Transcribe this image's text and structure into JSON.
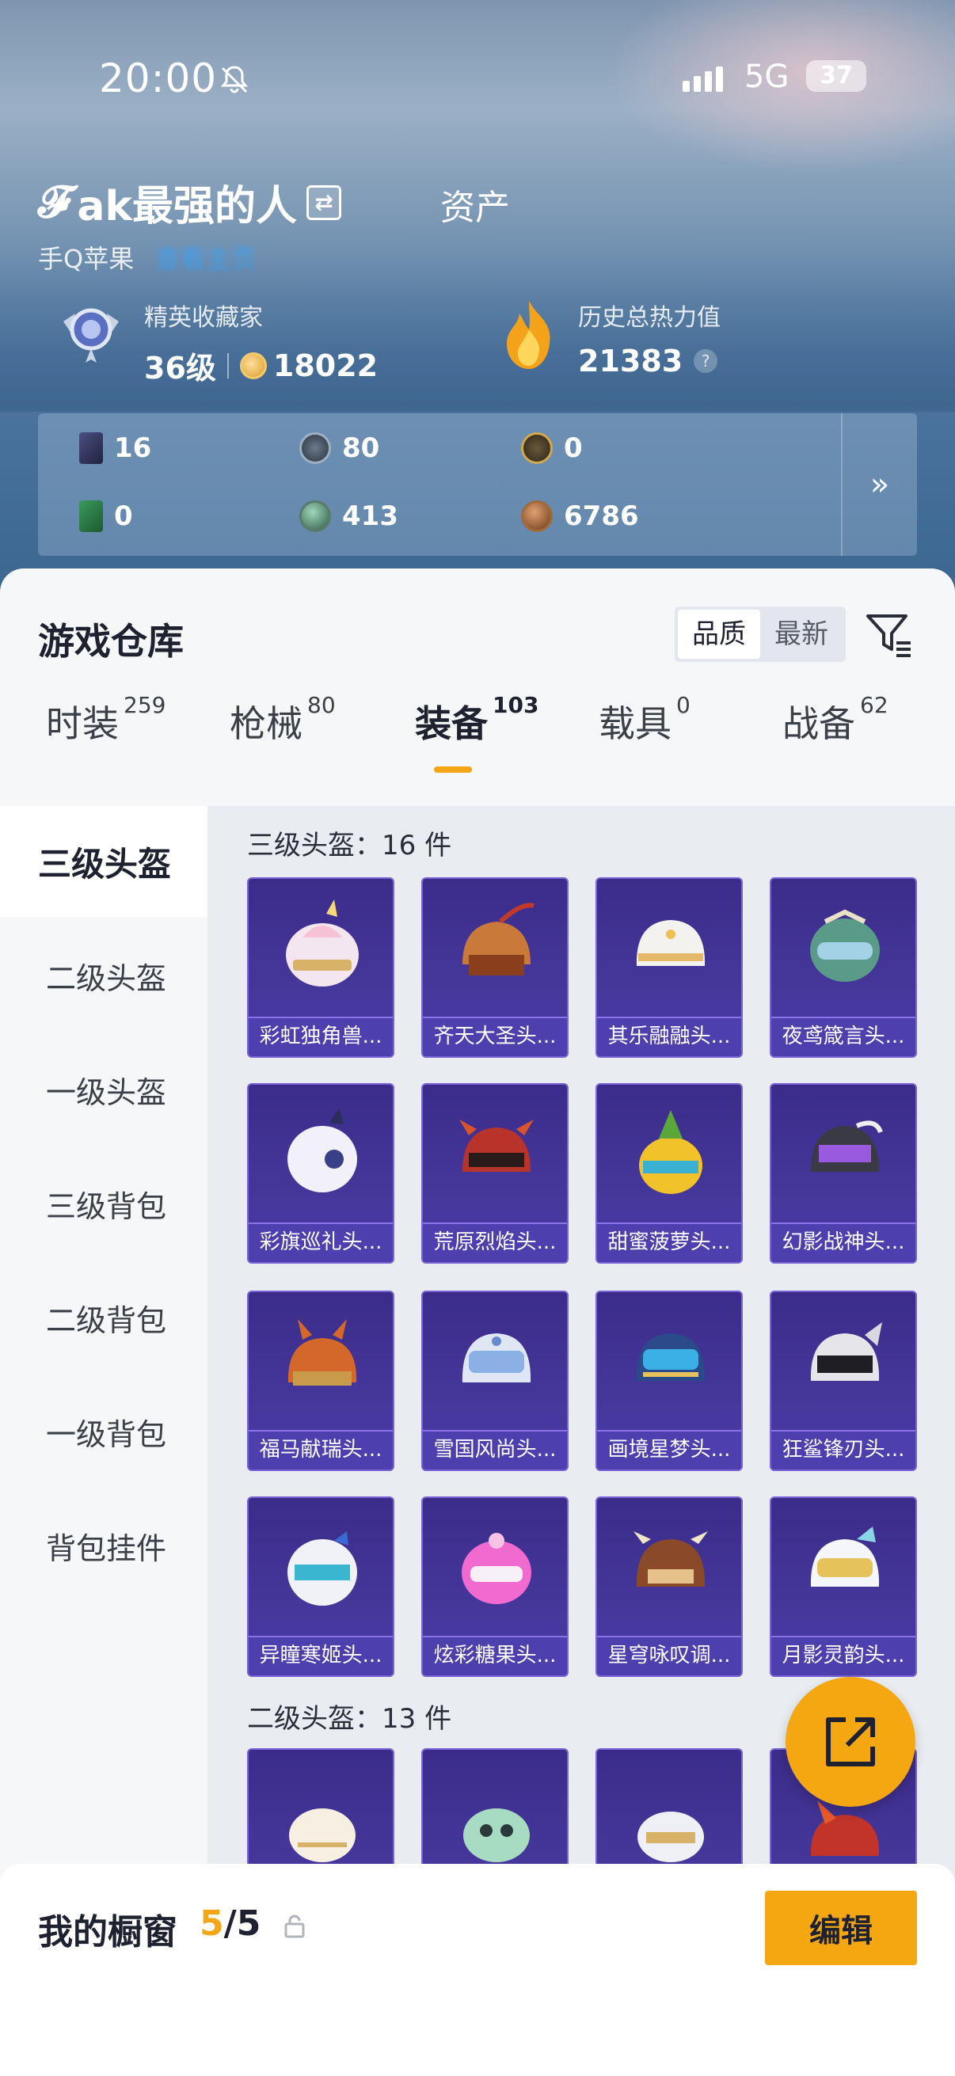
{
  "status_bar": {
    "time": "20:00",
    "network": "5G",
    "battery": "37"
  },
  "profile": {
    "name": "ak最强的人",
    "assets_tab": "资产",
    "platform": "手Q苹果",
    "blurred_tag": "查看主页"
  },
  "stats": {
    "collector_label": "精英收藏家",
    "level": "36级",
    "coins": "18022",
    "heat_label": "历史总热力值",
    "heat_value": "21383",
    "heat_help": "?"
  },
  "currencies": [
    {
      "icon": "card-icon",
      "value": "16"
    },
    {
      "icon": "s-coin-icon",
      "value": "80"
    },
    {
      "icon": "a-coin-icon",
      "value": "0"
    },
    {
      "icon": "green-card-icon",
      "value": "0"
    },
    {
      "icon": "orb-icon",
      "value": "413"
    },
    {
      "icon": "bronze-coin-icon",
      "value": "6786"
    }
  ],
  "warehouse": {
    "title": "游戏仓库",
    "sort_quality": "品质",
    "sort_newest": "最新",
    "tabs": [
      {
        "label": "时装",
        "count": "259"
      },
      {
        "label": "枪械",
        "count": "80"
      },
      {
        "label": "装备",
        "count": "103"
      },
      {
        "label": "载具",
        "count": "0"
      },
      {
        "label": "战备",
        "count": "62"
      }
    ],
    "side_items": [
      "三级头盔",
      "二级头盔",
      "一级头盔",
      "三级背包",
      "二级背包",
      "一级背包",
      "背包挂件"
    ],
    "group1_title": "三级头盔：16 件",
    "group2_title": "二级头盔：13 件",
    "items": [
      "彩虹独角兽...",
      "齐天大圣头...",
      "其乐融融头...",
      "夜鸢箴言头...",
      "彩旗巡礼头...",
      "荒原烈焰头...",
      "甜蜜菠萝头...",
      "幻影战神头...",
      "福马献瑞头...",
      "雪国风尚头...",
      "画境星梦头...",
      "狂鲨锋刃头...",
      "异瞳寒姬头...",
      "炫彩糖果头...",
      "星穹咏叹调...",
      "月影灵韵头..."
    ]
  },
  "showcase": {
    "label": "我的橱窗",
    "current": "5",
    "total": "/5",
    "edit": "编辑"
  },
  "colors": {
    "accent": "#f5a712",
    "card_purple": "#45379a"
  }
}
